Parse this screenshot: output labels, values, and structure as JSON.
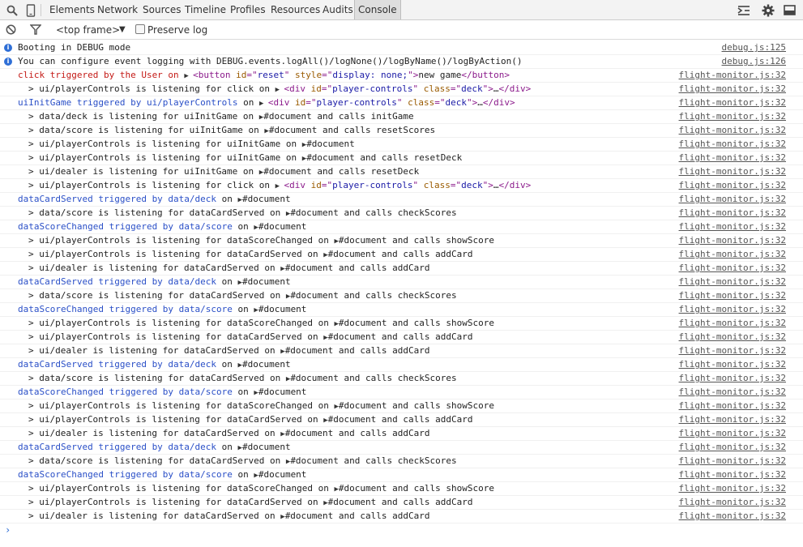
{
  "toolbar": {
    "tabs": [
      "Elements",
      "Network",
      "Sources",
      "Timeline",
      "Profiles",
      "Resources",
      "Audits",
      "Console"
    ],
    "selected_tab": "Console"
  },
  "filterbar": {
    "frame": "<top frame>",
    "preserve_log": "Preserve log"
  },
  "colors": {
    "accent": "#2f6fd6",
    "event_blue": "#2a4fc7",
    "event_red": "#c41a16"
  },
  "rows": [
    {
      "type": "info",
      "text": "Booting in DEBUG mode",
      "src": "debug.js:125"
    },
    {
      "type": "info",
      "text": "You can configure event logging with DEBUG.events.logAll()/logNone()/logByName()/logByAction()",
      "src": "debug.js:126"
    },
    {
      "type": "group",
      "color": "red",
      "head": "click triggered by the User on ",
      "node": {
        "tag": "button",
        "attrs": [
          [
            "id",
            "reset"
          ],
          [
            "style",
            "display: none;"
          ]
        ],
        "inner": "new game",
        "close": true
      },
      "src": "flight-monitor.js:32"
    },
    {
      "type": "child",
      "pre": "> ui/playerControls is listening for click on ",
      "node": {
        "tag": "div",
        "attrs": [
          [
            "id",
            "player-controls"
          ],
          [
            "class",
            "deck"
          ]
        ],
        "inner": "…",
        "close": true,
        "expand": true
      },
      "post": "",
      "src": "flight-monitor.js:32"
    },
    {
      "type": "group",
      "color": "blue",
      "head": "uiInitGame triggered by ui/playerControls ",
      "on": " on ",
      "node": {
        "tag": "div",
        "attrs": [
          [
            "id",
            "player-controls"
          ],
          [
            "class",
            "deck"
          ]
        ],
        "inner": "…",
        "close": true,
        "expand": true
      },
      "src": "flight-monitor.js:32"
    },
    {
      "type": "child",
      "pre": "> data/deck is listening for uiInitGame on ",
      "doc": "#document",
      "post": " and calls initGame",
      "src": "flight-monitor.js:32"
    },
    {
      "type": "child",
      "pre": "> data/score is listening for uiInitGame on ",
      "doc": "#document",
      "post": " and calls resetScores",
      "src": "flight-monitor.js:32"
    },
    {
      "type": "child",
      "pre": "> ui/playerControls is listening for uiInitGame on ",
      "doc": "#document",
      "post": "",
      "src": "flight-monitor.js:32"
    },
    {
      "type": "child",
      "pre": "> ui/playerControls is listening for uiInitGame on ",
      "doc": "#document",
      "post": " and calls resetDeck",
      "src": "flight-monitor.js:32"
    },
    {
      "type": "child",
      "pre": "> ui/dealer is listening for uiInitGame on ",
      "doc": "#document",
      "post": " and calls resetDeck",
      "src": "flight-monitor.js:32"
    },
    {
      "type": "child",
      "pre": "> ui/playerControls is listening for click on ",
      "node": {
        "tag": "div",
        "attrs": [
          [
            "id",
            "player-controls"
          ],
          [
            "class",
            "deck"
          ]
        ],
        "inner": "…",
        "close": true,
        "expand": true
      },
      "post": "",
      "src": "flight-monitor.js:32"
    },
    {
      "type": "group",
      "color": "blue",
      "head": "dataCardServed triggered by data/deck ",
      "on": " on ",
      "doc": "#document",
      "src": "flight-monitor.js:32"
    },
    {
      "type": "child",
      "pre": "> data/score is listening for dataCardServed on ",
      "doc": "#document",
      "post": " and calls checkScores",
      "src": "flight-monitor.js:32"
    },
    {
      "type": "group",
      "color": "blue",
      "head": "dataScoreChanged triggered by data/score ",
      "on": " on ",
      "doc": "#document",
      "src": "flight-monitor.js:32"
    },
    {
      "type": "child",
      "pre": "> ui/playerControls is listening for dataScoreChanged on ",
      "doc": "#document",
      "post": " and calls showScore",
      "src": "flight-monitor.js:32"
    },
    {
      "type": "child",
      "pre": "> ui/playerControls is listening for dataCardServed on ",
      "doc": "#document",
      "post": " and calls addCard",
      "src": "flight-monitor.js:32"
    },
    {
      "type": "child",
      "pre": "> ui/dealer is listening for dataCardServed on ",
      "doc": "#document",
      "post": " and calls addCard",
      "src": "flight-monitor.js:32"
    },
    {
      "type": "group",
      "color": "blue",
      "head": "dataCardServed triggered by data/deck ",
      "on": " on ",
      "doc": "#document",
      "src": "flight-monitor.js:32"
    },
    {
      "type": "child",
      "pre": "> data/score is listening for dataCardServed on ",
      "doc": "#document",
      "post": " and calls checkScores",
      "src": "flight-monitor.js:32"
    },
    {
      "type": "group",
      "color": "blue",
      "head": "dataScoreChanged triggered by data/score ",
      "on": " on ",
      "doc": "#document",
      "src": "flight-monitor.js:32"
    },
    {
      "type": "child",
      "pre": "> ui/playerControls is listening for dataScoreChanged on ",
      "doc": "#document",
      "post": " and calls showScore",
      "src": "flight-monitor.js:32"
    },
    {
      "type": "child",
      "pre": "> ui/playerControls is listening for dataCardServed on ",
      "doc": "#document",
      "post": " and calls addCard",
      "src": "flight-monitor.js:32"
    },
    {
      "type": "child",
      "pre": "> ui/dealer is listening for dataCardServed on ",
      "doc": "#document",
      "post": " and calls addCard",
      "src": "flight-monitor.js:32"
    },
    {
      "type": "group",
      "color": "blue",
      "head": "dataCardServed triggered by data/deck ",
      "on": " on ",
      "doc": "#document",
      "src": "flight-monitor.js:32"
    },
    {
      "type": "child",
      "pre": "> data/score is listening for dataCardServed on ",
      "doc": "#document",
      "post": " and calls checkScores",
      "src": "flight-monitor.js:32"
    },
    {
      "type": "group",
      "color": "blue",
      "head": "dataScoreChanged triggered by data/score ",
      "on": " on ",
      "doc": "#document",
      "src": "flight-monitor.js:32"
    },
    {
      "type": "child",
      "pre": "> ui/playerControls is listening for dataScoreChanged on ",
      "doc": "#document",
      "post": " and calls showScore",
      "src": "flight-monitor.js:32"
    },
    {
      "type": "child",
      "pre": "> ui/playerControls is listening for dataCardServed on ",
      "doc": "#document",
      "post": " and calls addCard",
      "src": "flight-monitor.js:32"
    },
    {
      "type": "child",
      "pre": "> ui/dealer is listening for dataCardServed on ",
      "doc": "#document",
      "post": " and calls addCard",
      "src": "flight-monitor.js:32"
    },
    {
      "type": "group",
      "color": "blue",
      "head": "dataCardServed triggered by data/deck ",
      "on": " on ",
      "doc": "#document",
      "src": "flight-monitor.js:32"
    },
    {
      "type": "child",
      "pre": "> data/score is listening for dataCardServed on ",
      "doc": "#document",
      "post": " and calls checkScores",
      "src": "flight-monitor.js:32"
    },
    {
      "type": "group",
      "color": "blue",
      "head": "dataScoreChanged triggered by data/score ",
      "on": " on ",
      "doc": "#document",
      "src": "flight-monitor.js:32"
    },
    {
      "type": "child",
      "pre": "> ui/playerControls is listening for dataScoreChanged on ",
      "doc": "#document",
      "post": " and calls showScore",
      "src": "flight-monitor.js:32"
    },
    {
      "type": "child",
      "pre": "> ui/playerControls is listening for dataCardServed on ",
      "doc": "#document",
      "post": " and calls addCard",
      "src": "flight-monitor.js:32"
    },
    {
      "type": "child",
      "pre": "> ui/dealer is listening for dataCardServed on ",
      "doc": "#document",
      "post": " and calls addCard",
      "src": "flight-monitor.js:32"
    }
  ]
}
